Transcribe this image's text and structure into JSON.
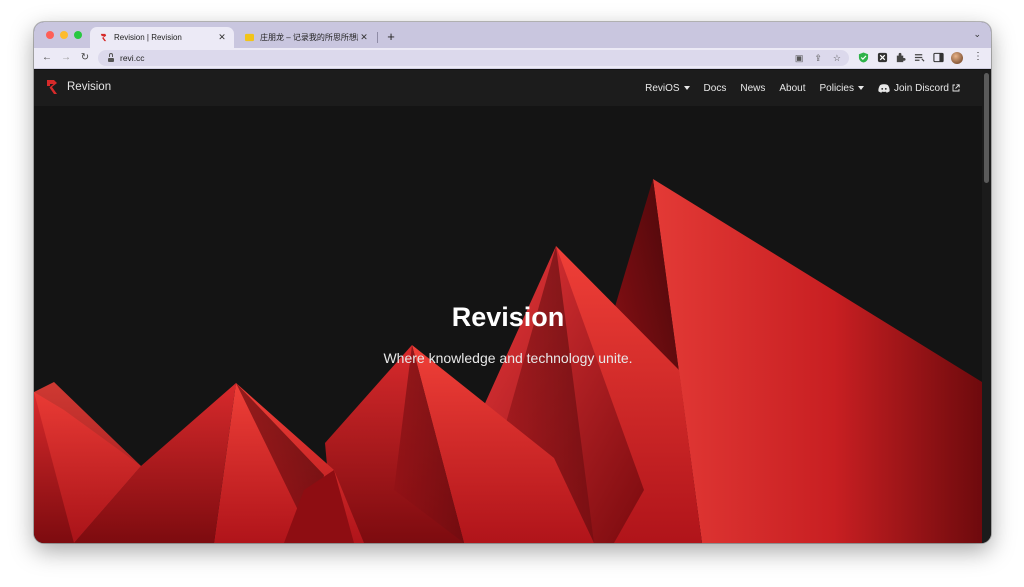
{
  "browser": {
    "tabs": [
      {
        "title": "Revision | Revision",
        "close": "✕"
      },
      {
        "title": "庄朋龙 – 记录我的所思所想所得（",
        "close": "✕"
      }
    ],
    "new_tab": "+",
    "tab_list": "⌄",
    "url": "revi.cc",
    "menu": "⋮"
  },
  "site": {
    "brand": "Revision",
    "nav": [
      {
        "label": "ReviOS",
        "dropdown": true
      },
      {
        "label": "Docs"
      },
      {
        "label": "News"
      },
      {
        "label": "About"
      },
      {
        "label": "Policies",
        "dropdown": true
      },
      {
        "label": "Join Discord",
        "external": true
      }
    ],
    "hero": {
      "title": "Revision",
      "subtitle": "Where knowledge and technology unite."
    }
  },
  "colors": {
    "accent": "#d62a2a",
    "background": "#141414",
    "navbar": "#1c1c1c"
  }
}
